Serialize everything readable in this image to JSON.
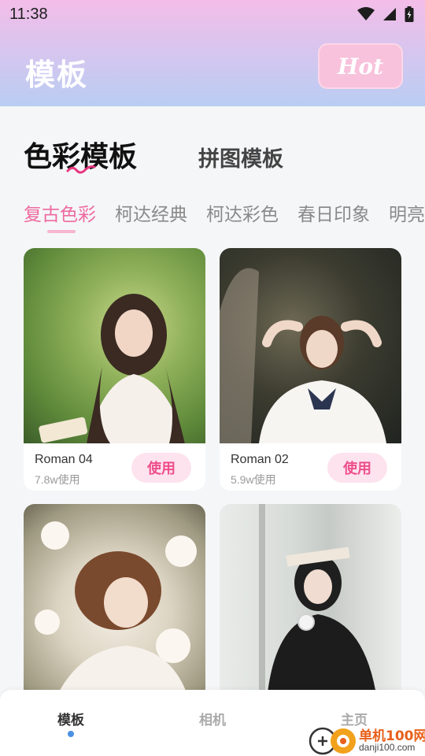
{
  "status_bar": {
    "time": "11:38",
    "icons": [
      "wifi-icon",
      "signal-icon",
      "battery-icon"
    ]
  },
  "header": {
    "title": "模板",
    "hot_label": "Hot"
  },
  "main_tabs": [
    {
      "label": "色彩模板",
      "active": true
    },
    {
      "label": "拼图模板",
      "active": false
    }
  ],
  "sub_tabs": [
    {
      "label": "复古色彩",
      "active": true
    },
    {
      "label": "柯达经典",
      "active": false
    },
    {
      "label": "柯达彩色",
      "active": false
    },
    {
      "label": "春日印象",
      "active": false
    },
    {
      "label": "明亮",
      "active": false
    }
  ],
  "cards": [
    {
      "name": "Roman 04",
      "uses": "7.8w使用",
      "button": "使用"
    },
    {
      "name": "Roman 02",
      "uses": "5.9w使用",
      "button": "使用"
    },
    {
      "name": "",
      "uses": "",
      "button": ""
    },
    {
      "name": "",
      "uses": "",
      "button": ""
    }
  ],
  "bottom_nav": [
    {
      "label": "模板",
      "active": true
    },
    {
      "label": "相机",
      "active": false
    },
    {
      "label": "主页",
      "active": false
    }
  ],
  "watermark": {
    "text": "单机100网",
    "url": "danji100.com"
  },
  "colors": {
    "accent_pink": "#ee6aa0",
    "use_button_bg": "#fde3ee",
    "nav_dot": "#4a90e2"
  }
}
